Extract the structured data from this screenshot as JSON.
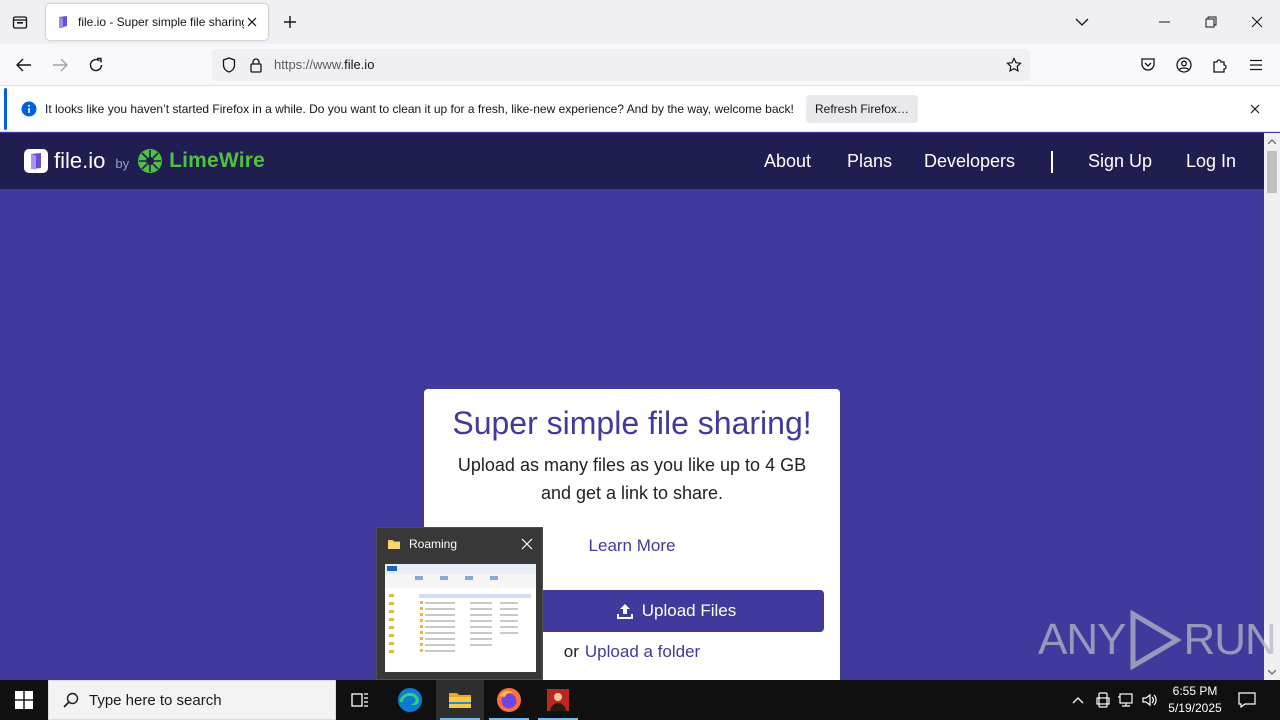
{
  "browser": {
    "tab": {
      "title": "file.io - Super simple file sharing",
      "favicon": "fileio-favicon"
    },
    "url": {
      "scheme": "https://www.",
      "host": "file.io"
    },
    "notification": {
      "text": "It looks like you haven’t started Firefox in a while. Do you want to clean it up for a fresh, like-new experience? And by the way, welcome back!",
      "button_label": "Refresh Firefox…"
    }
  },
  "site": {
    "logo_text": "file.io",
    "logo_by": "by",
    "partner_name": "LimeWire",
    "nav": {
      "about": "About",
      "plans": "Plans",
      "developers": "Developers",
      "sign_up": "Sign Up",
      "log_in": "Log In"
    },
    "card": {
      "title": "Super simple file sharing!",
      "subtitle": "Upload as many files as you like up to 4 GB and get a link to share.",
      "learn_more": "Learn More",
      "upload_button": "Upload Files",
      "or_text": "or",
      "upload_folder": "Upload a folder"
    }
  },
  "watermark": {
    "text": "ANY",
    "text2": "RUN"
  },
  "thumbnail_preview": {
    "title": "Roaming"
  },
  "taskbar": {
    "search_placeholder": "Type here to search",
    "apps": [
      "task-view",
      "edge",
      "file-explorer",
      "firefox",
      "unknown-app"
    ],
    "clock_time": "6:55 PM",
    "clock_date": "5/19/2025"
  },
  "colors": {
    "page_bg": "#3f3a9b",
    "header_bg": "#201e50",
    "accent": "#3f3a9b",
    "limewire_green": "#4fc13e",
    "firefox_blue": "#0060df"
  }
}
